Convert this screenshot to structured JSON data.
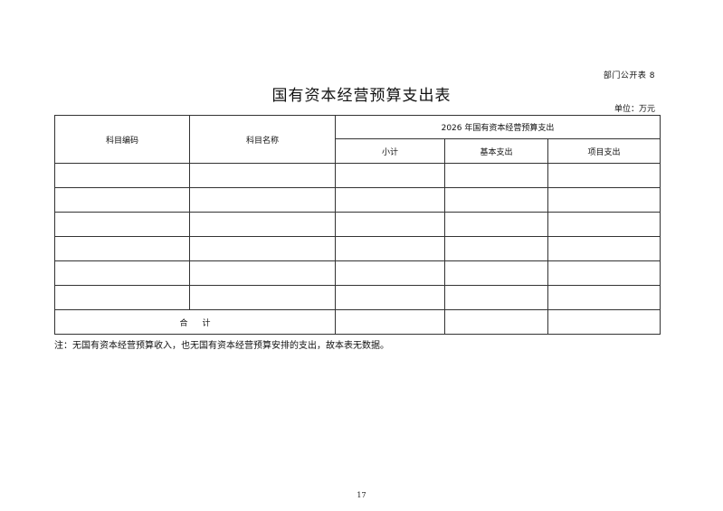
{
  "header": {
    "page_label": "部门公开表 8",
    "title": "国有资本经营预算支出表",
    "unit": "单位：万元"
  },
  "table": {
    "col_code": "科目编码",
    "col_name": "科目名称",
    "group_header": "2026 年国有资本经营预算支出",
    "sub_headers": [
      "小计",
      "基本支出",
      "项目支出"
    ],
    "rows": [
      [
        "",
        "",
        "",
        "",
        ""
      ],
      [
        "",
        "",
        "",
        "",
        ""
      ],
      [
        "",
        "",
        "",
        "",
        ""
      ],
      [
        "",
        "",
        "",
        "",
        ""
      ],
      [
        "",
        "",
        "",
        "",
        ""
      ],
      [
        "",
        "",
        "",
        "",
        ""
      ]
    ],
    "total_label": "合计",
    "total_values": [
      "",
      "",
      ""
    ]
  },
  "footer": {
    "note": "注：无国有资本经营预算收入，也无国有资本经营预算安排的支出，故本表无数据。",
    "page_number": "17"
  }
}
